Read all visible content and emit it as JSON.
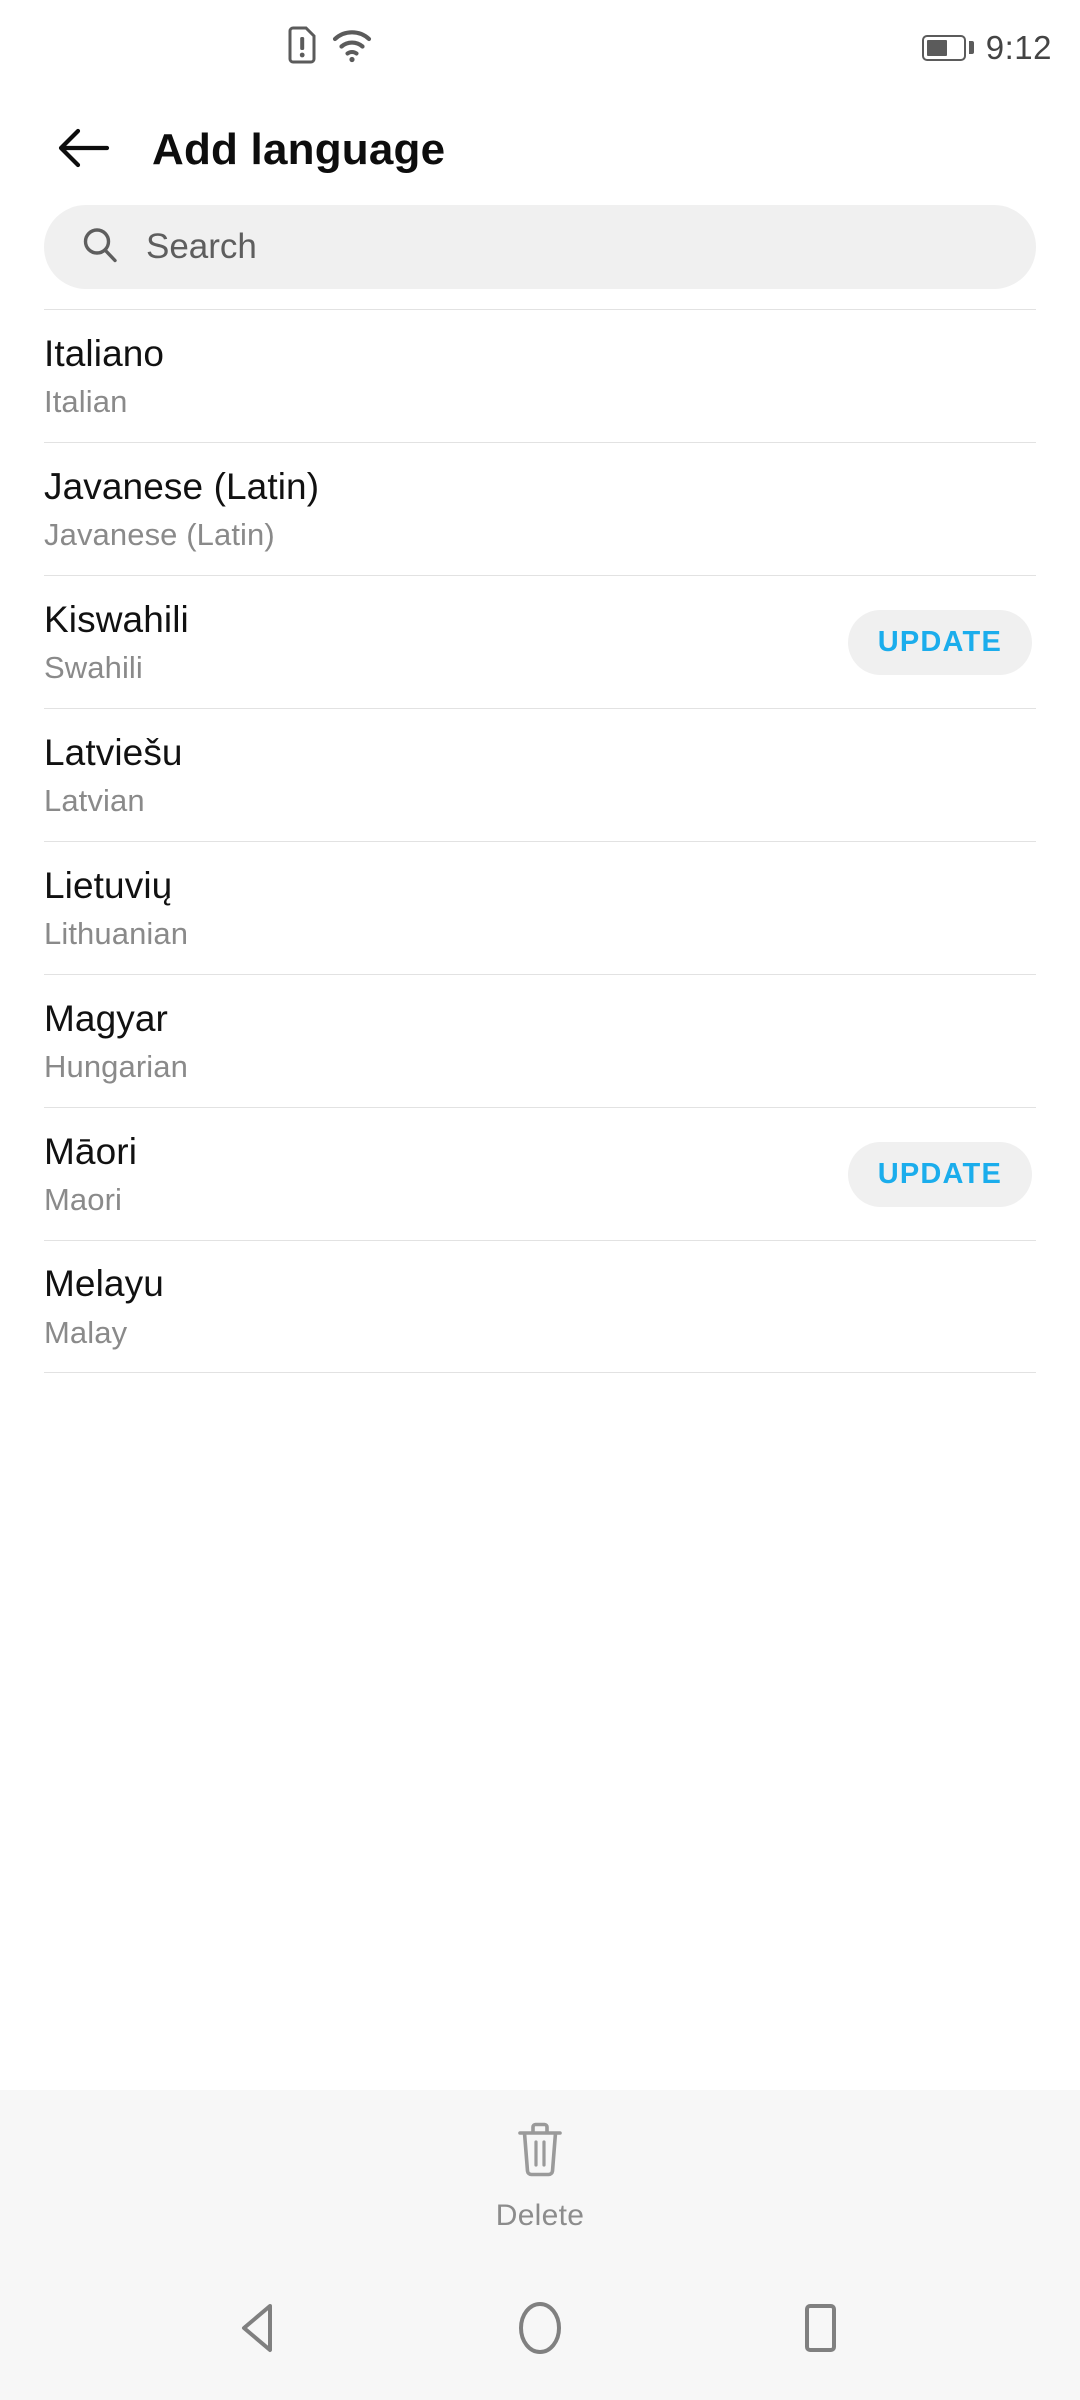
{
  "status_bar": {
    "sim_icon": "sim-card-alert-icon",
    "wifi_icon": "wifi-icon",
    "battery_icon": "battery-icon",
    "battery_level_percent": 60,
    "time": "9:12"
  },
  "header": {
    "back_icon": "arrow-left-icon",
    "title": "Add language"
  },
  "search": {
    "icon": "search-icon",
    "placeholder": "Search",
    "value": ""
  },
  "languages": [
    {
      "native": "Italiano",
      "english": "Italian",
      "action": null
    },
    {
      "native": "Javanese (Latin)",
      "english": "Javanese (Latin)",
      "action": null
    },
    {
      "native": "Kiswahili",
      "english": "Swahili",
      "action": "UPDATE"
    },
    {
      "native": "Latviešu",
      "english": "Latvian",
      "action": null
    },
    {
      "native": "Lietuvių",
      "english": "Lithuanian",
      "action": null
    },
    {
      "native": "Magyar",
      "english": "Hungarian",
      "action": null
    },
    {
      "native": "Māori",
      "english": "Maori",
      "action": "UPDATE"
    },
    {
      "native": "Melayu",
      "english": "Malay",
      "action": null
    }
  ],
  "bottom_bar": {
    "delete_icon": "trash-icon",
    "delete_label": "Delete"
  },
  "nav_bar": {
    "back_icon": "nav-back-triangle-icon",
    "home_icon": "nav-home-circle-icon",
    "recents_icon": "nav-recents-square-icon"
  },
  "colors": {
    "accent": "#1badec",
    "primary_text": "#111111",
    "secondary_text": "#8a8a8a",
    "divider": "#e2e2e2",
    "surface": "#f0f0f0",
    "bottom_surface": "#f7f7f7"
  }
}
